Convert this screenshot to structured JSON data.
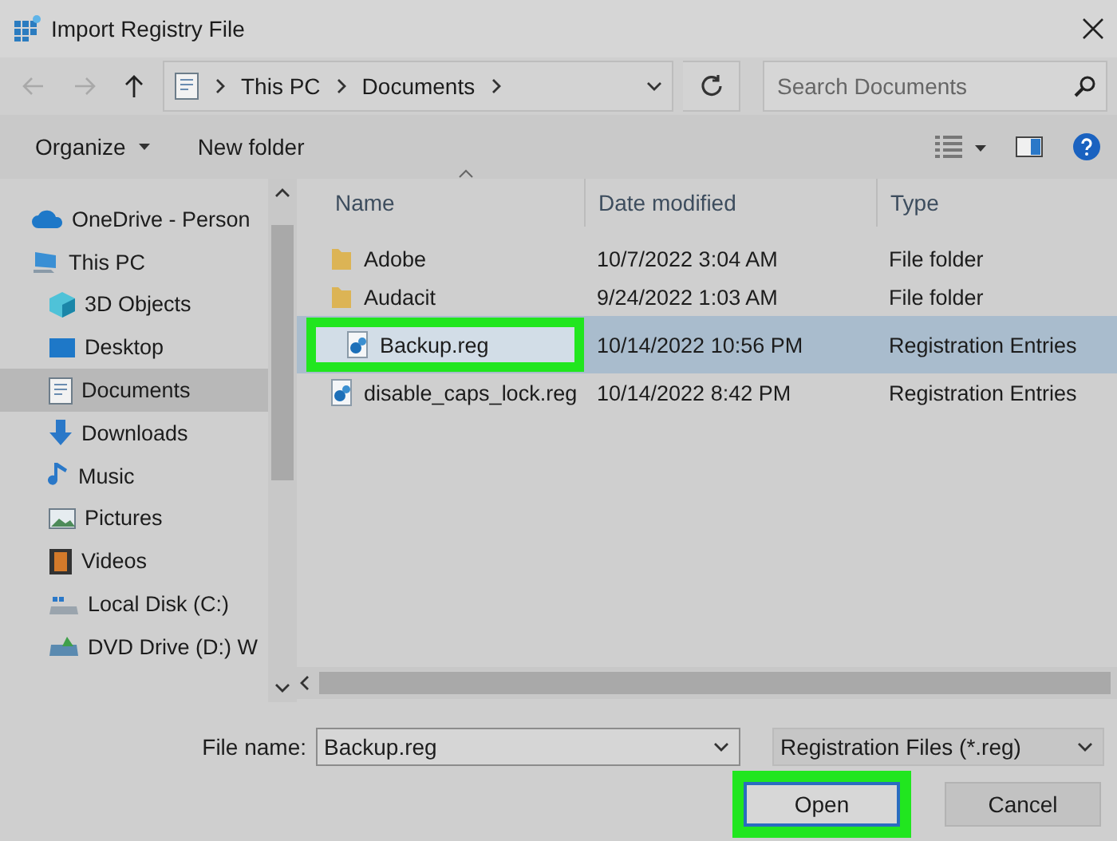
{
  "window": {
    "title": "Import Registry File"
  },
  "navigation": {
    "back": {
      "disabled": true
    },
    "forward": {
      "disabled": true
    },
    "up": {
      "disabled": false
    },
    "path": [
      "This PC",
      "Documents"
    ],
    "search": {
      "placeholder": "Search Documents"
    }
  },
  "toolbar": {
    "organize": "Organize",
    "new_folder": "New folder"
  },
  "sidebar": {
    "items": [
      {
        "label": "OneDrive - Person",
        "selected": false
      },
      {
        "label": "This PC",
        "selected": false,
        "children": [
          {
            "label": "3D Objects",
            "selected": false
          },
          {
            "label": "Desktop",
            "selected": false
          },
          {
            "label": "Documents",
            "selected": true
          },
          {
            "label": "Downloads",
            "selected": false
          },
          {
            "label": "Music",
            "selected": false
          },
          {
            "label": "Pictures",
            "selected": false
          },
          {
            "label": "Videos",
            "selected": false
          },
          {
            "label": "Local Disk (C:)",
            "selected": false
          },
          {
            "label": "DVD Drive (D:) W",
            "selected": false
          }
        ]
      }
    ]
  },
  "files": {
    "columns": [
      "Name",
      "Date modified",
      "Type"
    ],
    "rows": [
      {
        "kind": "folder",
        "name": "Adobe",
        "date": "10/7/2022 3:04 AM",
        "type": "File folder",
        "selected": false,
        "highlighted": false
      },
      {
        "kind": "folder",
        "name": "Audacit",
        "date": "9/24/2022 1:03 AM",
        "type": "File folder",
        "selected": false,
        "highlighted": false
      },
      {
        "kind": "registry",
        "name": "Backup.reg",
        "date": "10/14/2022 10:56 PM",
        "type": "Registration Entries",
        "selected": true,
        "highlighted": true
      },
      {
        "kind": "registry",
        "name": "disable_caps_lock.reg",
        "date": "10/14/2022 8:42 PM",
        "type": "Registration Entries",
        "selected": false,
        "highlighted": false
      }
    ]
  },
  "footer": {
    "file_name_label": "File name:",
    "file_name": "Backup.reg",
    "file_type": "Registration Files (*.reg)",
    "buttons": [
      {
        "label": "Open",
        "highlighted": true
      },
      {
        "label": "Cancel",
        "highlighted": false
      }
    ]
  }
}
